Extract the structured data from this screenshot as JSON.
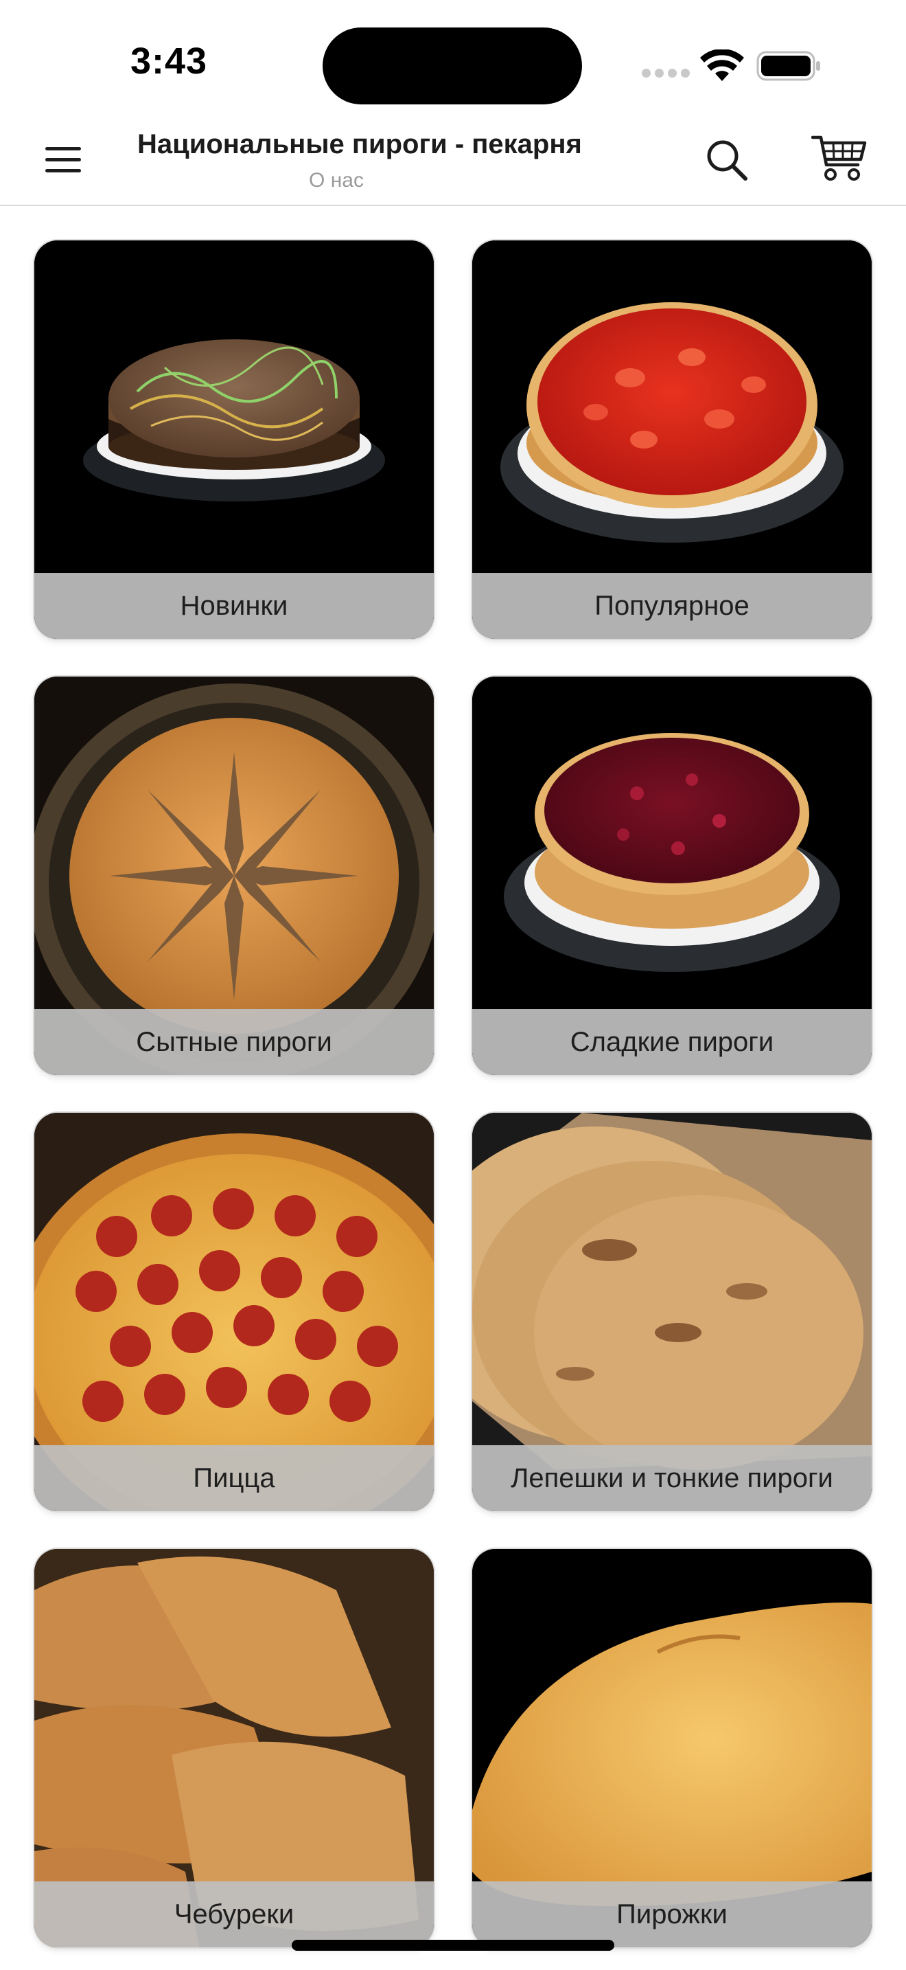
{
  "status_bar": {
    "time": "3:43"
  },
  "header": {
    "title": "Национальные пироги - пекарня",
    "subtitle": "О нас",
    "icons": {
      "menu": "hamburger-menu-icon",
      "search": "search-icon",
      "cart": "shopping-cart-icon"
    }
  },
  "categories": [
    {
      "label": "Новинки",
      "image": "chocolate-cake-photo"
    },
    {
      "label": "Популярное",
      "image": "strawberry-tart-photo"
    },
    {
      "label": "Сытные пироги",
      "image": "savory-pie-photo"
    },
    {
      "label": "Сладкие пироги",
      "image": "cherry-tart-photo"
    },
    {
      "label": "Пицца",
      "image": "pepperoni-pizza-photo"
    },
    {
      "label": "Лепешки и тонкие пироги",
      "image": "flatbread-photo"
    },
    {
      "label": "Чебуреки",
      "image": "chebureki-photo"
    },
    {
      "label": "Пирожки",
      "image": "pirozhok-photo"
    }
  ]
}
